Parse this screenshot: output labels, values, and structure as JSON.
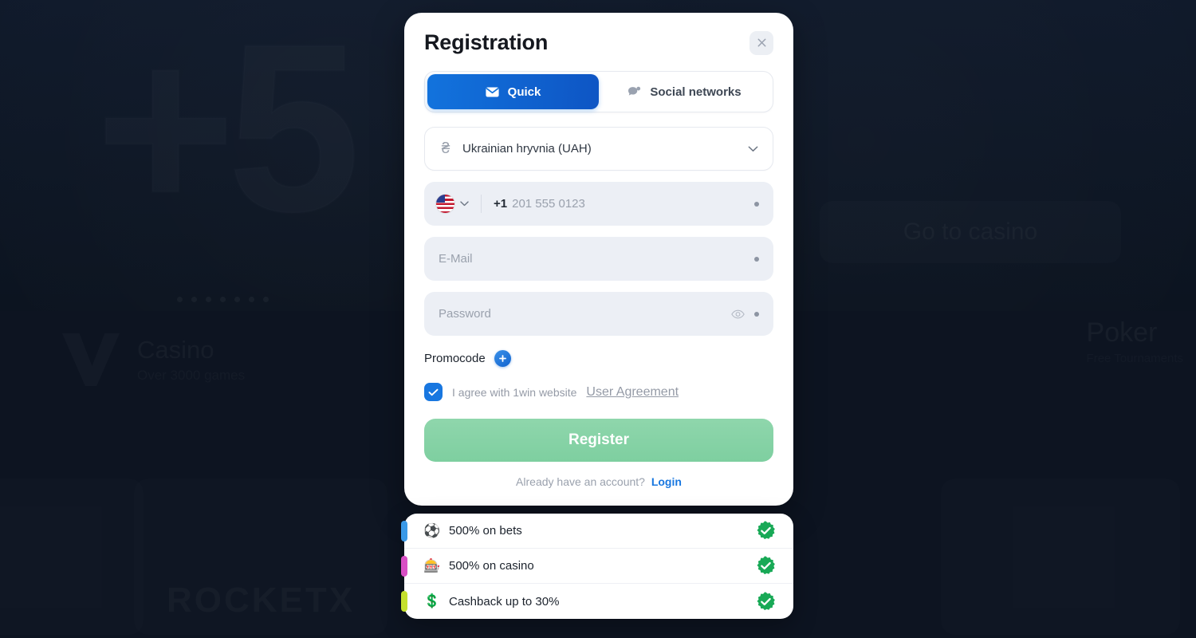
{
  "background": {
    "banner_text": "+5",
    "go_to_casino": "Go to casino",
    "casino_title": "Casino",
    "casino_subtitle": "Over 3000 games",
    "poker_title": "Poker",
    "poker_subtitle": "Free Tournaments",
    "rocketx_title": "ROCKETX",
    "page_bg_color": "#0d1421"
  },
  "modal": {
    "title": "Registration",
    "close_icon": "close-icon",
    "tabs": [
      {
        "label": "Quick",
        "icon": "envelope-icon",
        "active": true
      },
      {
        "label": "Social networks",
        "icon": "chat-bubble-icon",
        "active": false
      }
    ],
    "currency": {
      "symbol": "₴",
      "value": "Ukrainian hryvnia (UAH)",
      "chevron_icon": "chevron-down-icon"
    },
    "phone": {
      "flag": "us-flag-icon",
      "chevron_icon": "chevron-down-icon",
      "dial_code": "+1",
      "placeholder": "201 555 0123",
      "value": "",
      "required_marker": "required-dot"
    },
    "email": {
      "placeholder": "E-Mail",
      "value": "",
      "required_marker": "required-dot"
    },
    "password": {
      "placeholder": "Password",
      "value": "",
      "toggle_icon": "eye-icon",
      "required_marker": "required-dot"
    },
    "promocode": {
      "label": "Promocode",
      "add_icon": "plus-icon"
    },
    "agreement": {
      "checked": true,
      "text": "I agree with 1win website",
      "link_text": "User Agreement",
      "check_icon": "checkmark-icon"
    },
    "register_label": "Register",
    "login_prompt": "Already have an account?",
    "login_label": "Login",
    "accent_blue": "#1273dd",
    "register_green": "#7ecfa0"
  },
  "bonuses": [
    {
      "label": "500% on bets",
      "emoji": "⚽",
      "icon": "soccer-ball-icon",
      "accent": "#3b9ae8",
      "status_icon": "green-check-badge-icon"
    },
    {
      "label": "500% on casino",
      "emoji": "🎰",
      "icon": "slot-machine-icon",
      "accent": "#d84ec4",
      "status_icon": "green-check-badge-icon"
    },
    {
      "label": "Cashback up to 30%",
      "emoji": "💲",
      "icon": "cashback-coin-icon",
      "accent": "#c5e02e",
      "status_icon": "green-check-badge-icon"
    }
  ]
}
